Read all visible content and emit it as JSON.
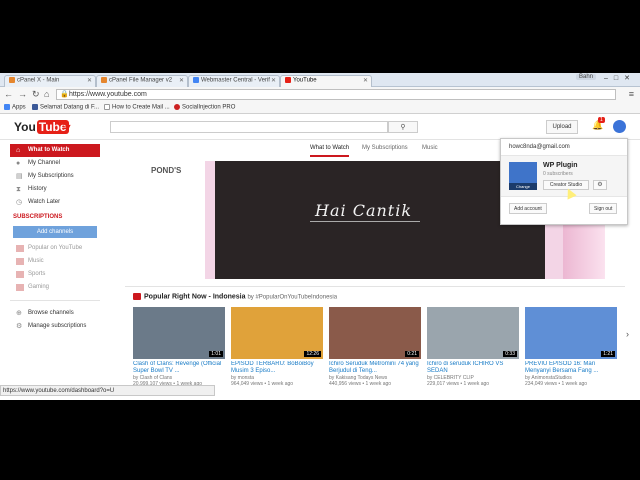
{
  "browser": {
    "tabs": [
      {
        "label": "cPanel X - Main",
        "color": "#e5862e"
      },
      {
        "label": "cPanel File Manager v2",
        "color": "#e5862e"
      },
      {
        "label": "Webmaster Central - Verif",
        "color": "#4285f4"
      },
      {
        "label": "YouTube",
        "color": "#e62117"
      }
    ],
    "user_chip": "Bahn",
    "url": "https://www.youtube.com",
    "bookmarks": [
      {
        "label": "Apps",
        "color": "#4285f4"
      },
      {
        "label": "Selamat Datang di F...",
        "color": "#3b5998"
      },
      {
        "label": "How to Create Mail ...",
        "color": "#ffffff"
      },
      {
        "label": "SocialInjection PRO",
        "color": "#cc2222"
      }
    ]
  },
  "header": {
    "logo_you": "You",
    "logo_tube": "Tube",
    "upload": "Upload",
    "notif_count": "1"
  },
  "sidebar": {
    "items": [
      {
        "label": "What to Watch",
        "icon": "home-icon"
      },
      {
        "label": "My Channel",
        "icon": "person-icon"
      },
      {
        "label": "My Subscriptions",
        "icon": "subscriptions-icon"
      },
      {
        "label": "History",
        "icon": "history-icon"
      },
      {
        "label": "Watch Later",
        "icon": "clock-icon"
      }
    ],
    "subs_heading": "SUBSCRIPTIONS",
    "add_channels": "Add channels",
    "subs": [
      "Popular on YouTube",
      "Music",
      "Sports",
      "Gaming"
    ],
    "browse": "Browse channels",
    "manage": "Manage subscriptions"
  },
  "main_tabs": [
    "What to Watch",
    "My Subscriptions",
    "Music"
  ],
  "banner": {
    "brand": "POND'S",
    "headline": "Hai Cantik"
  },
  "account": {
    "email": "howc8nda@gmail.com",
    "name": "WP Plugin",
    "subs": "0 subscribers",
    "change": "Change",
    "studio": "Creator Studio",
    "add": "Add account",
    "signout": "Sign out"
  },
  "popular": {
    "title": "Popular Right Now - Indonesia",
    "tag": "by #PopularOnYouTubeIndonesia",
    "videos": [
      {
        "title": "Clash of Clans: Revenge (Official Super Bowl TV ...",
        "by": "by Clash of Clans",
        "meta": "20,999,107 views • 1 week ago",
        "dur": "1:01",
        "color": "#6b7a89"
      },
      {
        "title": "EPISOD TERBARU: BoBoiBoy Musim 3 Episo...",
        "by": "by monsta",
        "meta": "964,049 views • 1 week ago",
        "dur": "12:26",
        "color": "#e0a23a"
      },
      {
        "title": "Ichiro Seruduk Metromini 74 yang Berjudul di Teng...",
        "by": "by Kakisang Todays News",
        "meta": "440,956 views • 1 week ago",
        "dur": "0:21",
        "color": "#8a5a4a"
      },
      {
        "title": "Ichiro di seruduk ICHIRO VS SEDAN",
        "by": "by CELEBRITY CLIP",
        "meta": "229,017 views • 1 week ago",
        "dur": "0:33",
        "color": "#9aa5ad"
      },
      {
        "title": "PREVIU EPISOD 16: Mari Menyanyi Bersama Fang ...",
        "by": "by AnimonstaStudios",
        "meta": "234,049 views • 1 week ago",
        "dur": "1:21",
        "color": "#5f8fd6"
      }
    ]
  },
  "status_url": "https://www.youtube.com/dashboard?o=U"
}
